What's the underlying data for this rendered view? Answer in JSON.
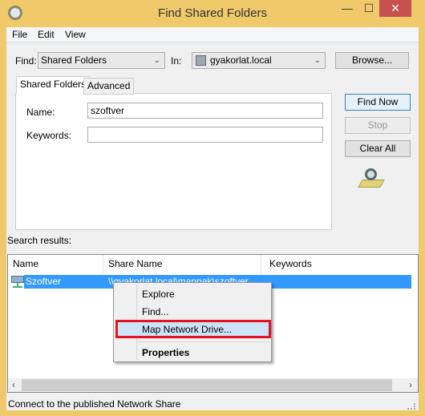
{
  "window": {
    "title": "Find Shared Folders",
    "minimize": "—",
    "maximize": "☐",
    "close": "✕"
  },
  "menubar": [
    "File",
    "Edit",
    "View"
  ],
  "find": {
    "label": "Find:",
    "value": "Shared Folders",
    "in_label": "In:",
    "in_value": "gyakorlat.local",
    "browse": "Browse..."
  },
  "tabs": [
    "Shared Folders",
    "Advanced"
  ],
  "form": {
    "name_label": "Name:",
    "name_value": "szoftver",
    "keywords_label": "Keywords:",
    "keywords_value": ""
  },
  "buttons": {
    "find_now": "Find Now",
    "stop": "Stop",
    "clear_all": "Clear All"
  },
  "results": {
    "label": "Search results:",
    "columns": [
      "Name",
      "Share Name",
      "Keywords"
    ],
    "rows": [
      {
        "name": "Szoftver",
        "share": "\\\\gyakorlat.local\\mappak\\szoftver",
        "keywords": ""
      }
    ]
  },
  "context_menu": {
    "items": [
      "Explore",
      "Find...",
      "Map Network Drive...",
      "Properties"
    ],
    "highlighted": "Map Network Drive..."
  },
  "status": "Connect to the published Network Share",
  "colors": {
    "frame": "#f0c96a",
    "close": "#c75050",
    "selection": "#3399ff",
    "highlight_box": "#e81123"
  }
}
